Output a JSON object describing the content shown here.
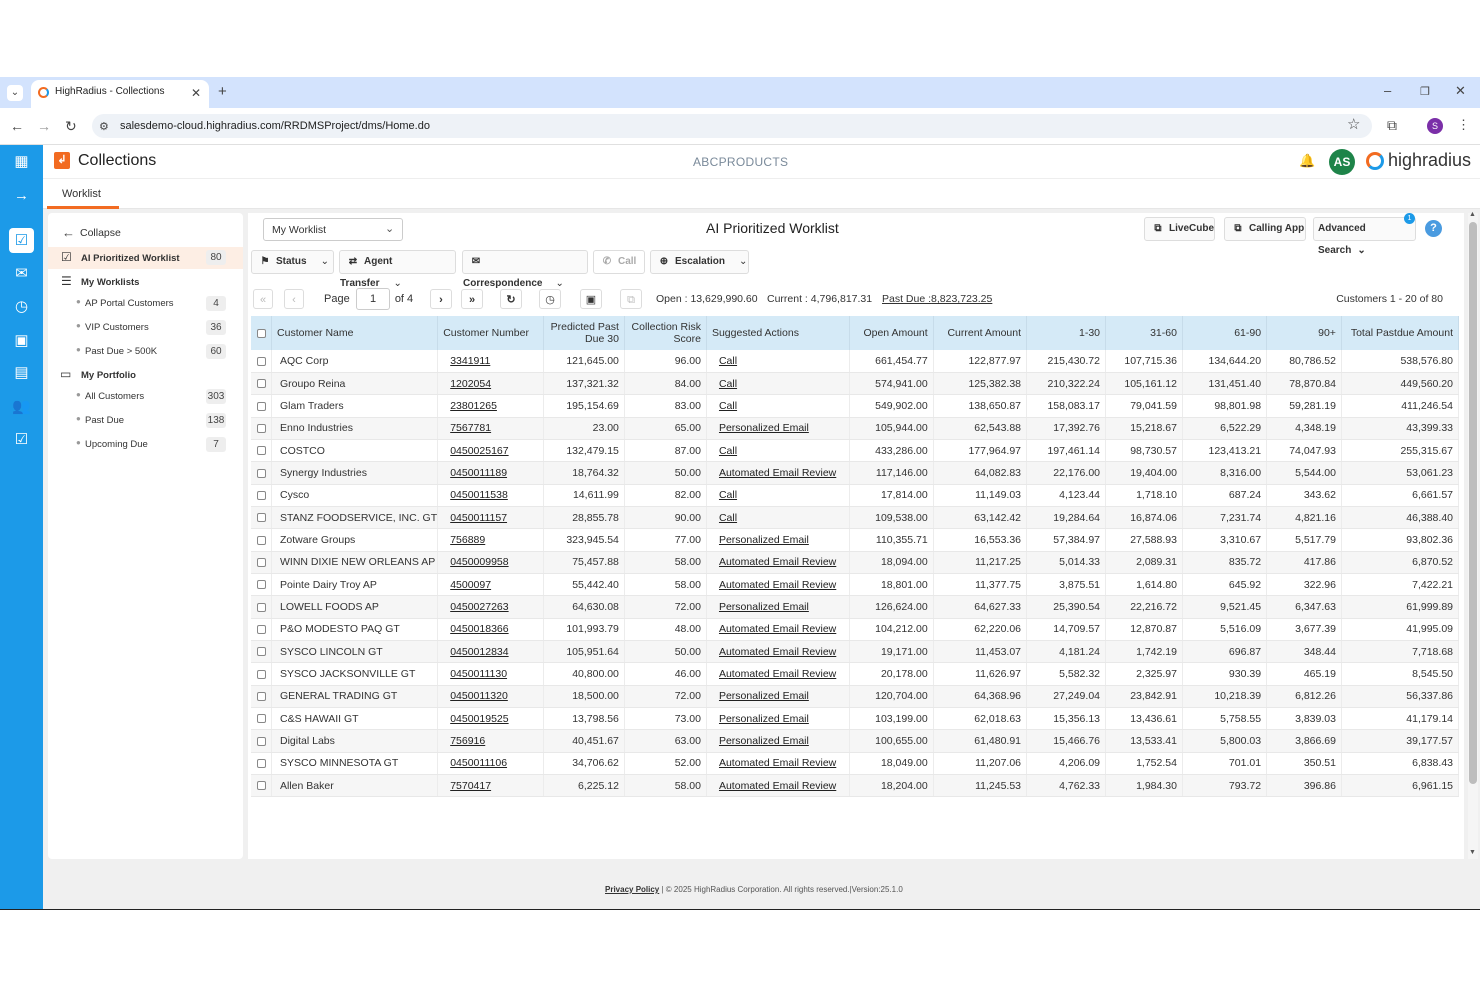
{
  "browser": {
    "tab_title": "HighRadius - Collections",
    "url": "salesdemo-cloud.highradius.com/RRDMSProject/dms/Home.do",
    "profile_initial": "S"
  },
  "header": {
    "app_title": "Collections",
    "brand_center": "ABCPRODUCTS",
    "user_initials": "AS",
    "logo_text": "highradius"
  },
  "subnav": {
    "tab": "Worklist"
  },
  "sidebar": {
    "collapse": "Collapse",
    "ai_worklist": {
      "label": "AI Prioritized Worklist",
      "count": "80"
    },
    "my_worklists": "My Worklists",
    "worklists": [
      {
        "label": "AP Portal Customers",
        "count": "4"
      },
      {
        "label": "VIP Customers",
        "count": "36"
      },
      {
        "label": "Past Due > 500K",
        "count": "60"
      }
    ],
    "my_portfolio": "My Portfolio",
    "portfolio": [
      {
        "label": "All Customers",
        "count": "303"
      },
      {
        "label": "Past Due",
        "count": "138"
      },
      {
        "label": "Upcoming Due",
        "count": "7"
      }
    ]
  },
  "main": {
    "worklist_select": "My Worklist",
    "title": "AI Prioritized Worklist",
    "livecube": "LiveCube",
    "calling_app": "Calling App",
    "advanced_search": "Advanced Search",
    "adv_badge": "1",
    "actions": {
      "status": "Status",
      "agent_transfer": "Agent Transfer",
      "correspondence": "Correspondence",
      "call": "Call",
      "escalation": "Escalation"
    },
    "pager": {
      "page_label": "Page",
      "page_value": "1",
      "of_label": "of 4",
      "open_label": "Open :",
      "open_value": "13,629,990.60",
      "current_label": "Current :",
      "current_value": "4,796,817.31",
      "pastdue_label": "Past Due :",
      "pastdue_value": "8,823,723.25",
      "customers_range": "Customers 1 - 20 of 80"
    },
    "columns": [
      "Customer Name",
      "Customer Number",
      "Predicted Past Due 30",
      "Collection Risk Score",
      "Suggested Actions",
      "Open Amount",
      "Current Amount",
      "1-30",
      "31-60",
      "61-90",
      "90+",
      "Total Pastdue Amount"
    ],
    "rows": [
      [
        "AQC Corp",
        "3341911",
        "121,645.00",
        "96.00",
        "Call",
        "661,454.77",
        "122,877.97",
        "215,430.72",
        "107,715.36",
        "134,644.20",
        "80,786.52",
        "538,576.80"
      ],
      [
        "Groupo Reina",
        "1202054",
        "137,321.32",
        "84.00",
        "Call",
        "574,941.00",
        "125,382.38",
        "210,322.24",
        "105,161.12",
        "131,451.40",
        "78,870.84",
        "449,560.20"
      ],
      [
        "Glam Traders",
        "23801265",
        "195,154.69",
        "83.00",
        "Call",
        "549,902.00",
        "138,650.87",
        "158,083.17",
        "79,041.59",
        "98,801.98",
        "59,281.19",
        "411,246.54"
      ],
      [
        "Enno Industries",
        "7567781",
        "23.00",
        "65.00",
        "Personalized Email",
        "105,944.00",
        "62,543.88",
        "17,392.76",
        "15,218.67",
        "6,522.29",
        "4,348.19",
        "43,399.33"
      ],
      [
        "COSTCO",
        "0450025167",
        "132,479.15",
        "87.00",
        "Call",
        "433,286.00",
        "177,964.97",
        "197,461.14",
        "98,730.57",
        "123,413.21",
        "74,047.93",
        "255,315.67"
      ],
      [
        "Synergy Industries",
        "0450011189",
        "18,764.32",
        "50.00",
        "Automated Email Review",
        "117,146.00",
        "64,082.83",
        "22,176.00",
        "19,404.00",
        "8,316.00",
        "5,544.00",
        "53,061.23"
      ],
      [
        "Cysco",
        "0450011538",
        "14,611.99",
        "82.00",
        "Call",
        "17,814.00",
        "11,149.03",
        "4,123.44",
        "1,718.10",
        "687.24",
        "343.62",
        "6,661.57"
      ],
      [
        "STANZ FOODSERVICE, INC. GT",
        "0450011157",
        "28,855.78",
        "90.00",
        "Call",
        "109,538.00",
        "63,142.42",
        "19,284.64",
        "16,874.06",
        "7,231.74",
        "4,821.16",
        "46,388.40"
      ],
      [
        "Zotware Groups",
        "756889",
        "323,945.54",
        "77.00",
        "Personalized Email",
        "110,355.71",
        "16,553.36",
        "57,384.97",
        "27,588.93",
        "3,310.67",
        "5,517.79",
        "93,802.36"
      ],
      [
        "WINN DIXIE NEW ORLEANS AP",
        "0450009958",
        "75,457.88",
        "58.00",
        "Automated Email Review",
        "18,094.00",
        "11,217.25",
        "5,014.33",
        "2,089.31",
        "835.72",
        "417.86",
        "6,870.52"
      ],
      [
        "Pointe Dairy Troy AP",
        "4500097",
        "55,442.40",
        "58.00",
        "Automated Email Review",
        "18,801.00",
        "11,377.75",
        "3,875.51",
        "1,614.80",
        "645.92",
        "322.96",
        "7,422.21"
      ],
      [
        "LOWELL FOODS AP",
        "0450027263",
        "64,630.08",
        "72.00",
        "Personalized Email",
        "126,624.00",
        "64,627.33",
        "25,390.54",
        "22,216.72",
        "9,521.45",
        "6,347.63",
        "61,999.89"
      ],
      [
        "P&O MODESTO PAQ GT",
        "0450018366",
        "101,993.79",
        "48.00",
        "Automated Email Review",
        "104,212.00",
        "62,220.06",
        "14,709.57",
        "12,870.87",
        "5,516.09",
        "3,677.39",
        "41,995.09"
      ],
      [
        "SYSCO LINCOLN GT",
        "0450012834",
        "105,951.64",
        "50.00",
        "Automated Email Review",
        "19,171.00",
        "11,453.07",
        "4,181.24",
        "1,742.19",
        "696.87",
        "348.44",
        "7,718.68"
      ],
      [
        "SYSCO JACKSONVILLE GT",
        "0450011130",
        "40,800.00",
        "46.00",
        "Automated Email Review",
        "20,178.00",
        "11,626.97",
        "5,582.32",
        "2,325.97",
        "930.39",
        "465.19",
        "8,545.50"
      ],
      [
        "GENERAL TRADING GT",
        "0450011320",
        "18,500.00",
        "72.00",
        "Personalized Email",
        "120,704.00",
        "64,368.96",
        "27,249.04",
        "23,842.91",
        "10,218.39",
        "6,812.26",
        "56,337.86"
      ],
      [
        "C&S HAWAII GT",
        "0450019525",
        "13,798.56",
        "73.00",
        "Personalized Email",
        "103,199.00",
        "62,018.63",
        "15,356.13",
        "13,436.61",
        "5,758.55",
        "3,839.03",
        "41,179.14"
      ],
      [
        "Digital Labs",
        "756916",
        "40,451.67",
        "63.00",
        "Personalized Email",
        "100,655.00",
        "61,480.91",
        "15,466.76",
        "13,533.41",
        "5,800.03",
        "3,866.69",
        "39,177.57"
      ],
      [
        "SYSCO MINNESOTA GT",
        "0450011106",
        "34,706.62",
        "52.00",
        "Automated Email Review",
        "18,049.00",
        "11,207.06",
        "4,206.09",
        "1,752.54",
        "701.01",
        "350.51",
        "6,838.43"
      ],
      [
        "Allen Baker",
        "7570417",
        "6,225.12",
        "58.00",
        "Automated Email Review",
        "18,204.00",
        "11,245.53",
        "4,762.33",
        "1,984.30",
        "793.72",
        "396.86",
        "6,961.15"
      ]
    ]
  },
  "footer": {
    "privacy": "Privacy Policy",
    "copyright": "| © 2025 HighRadius Corporation. All rights reserved.|Version:25.1.0"
  },
  "colors": {
    "rail": "#1c9ae8",
    "accent": "#f26b21",
    "header_row": "#d5eaf7",
    "avatar": "#1e8449"
  }
}
